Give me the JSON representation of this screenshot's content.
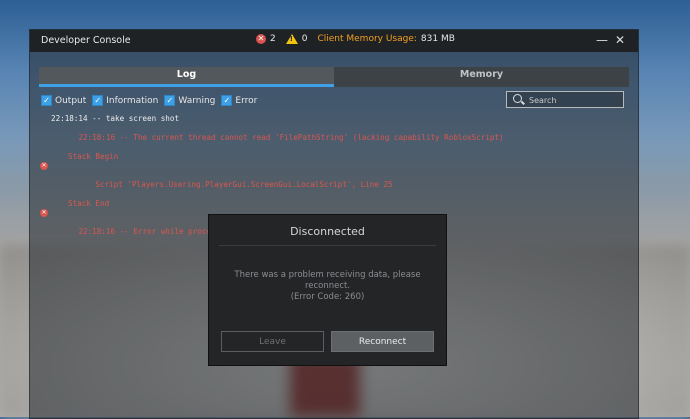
{
  "console": {
    "title": "Developer Console",
    "error_count": "2",
    "warning_count": "0",
    "memory_label": "Client Memory Usage:",
    "memory_value": "831 MB",
    "minimize_icon": "—",
    "close_icon": "✕"
  },
  "tabs": [
    {
      "label": "Log",
      "active": true
    },
    {
      "label": "Memory",
      "active": false
    }
  ],
  "filters": [
    {
      "label": "Output",
      "checked": true
    },
    {
      "label": "Information",
      "checked": true
    },
    {
      "label": "Warning",
      "checked": true
    },
    {
      "label": "Error",
      "checked": true
    }
  ],
  "search": {
    "placeholder": "Search"
  },
  "log": [
    {
      "type": "output",
      "text": "22:18:14 -- take screen shot"
    },
    {
      "type": "error",
      "text": "22:18:16 -- The current thread cannot read 'FilePathString' (lacking capability RobloxScript)"
    },
    {
      "type": "trace",
      "text": "Stack Begin"
    },
    {
      "type": "trace",
      "text": "Script 'Players.Usering.PlayerGui.ScreenGui.LocalScript', Line 25"
    },
    {
      "type": "trace",
      "text": "Stack End"
    },
    {
      "type": "error",
      "text": "22:18:16 -- Error while processing packet."
    }
  ],
  "dialog": {
    "title": "Disconnected",
    "message_line1": "There was a problem receiving data, please",
    "message_line2": "reconnect.",
    "message_line3": "(Error Code: 260)",
    "leave_label": "Leave",
    "reconnect_label": "Reconnect"
  },
  "colors": {
    "accent": "#3ea0e6",
    "error": "#d9574e",
    "memory_label": "#f0a020"
  }
}
